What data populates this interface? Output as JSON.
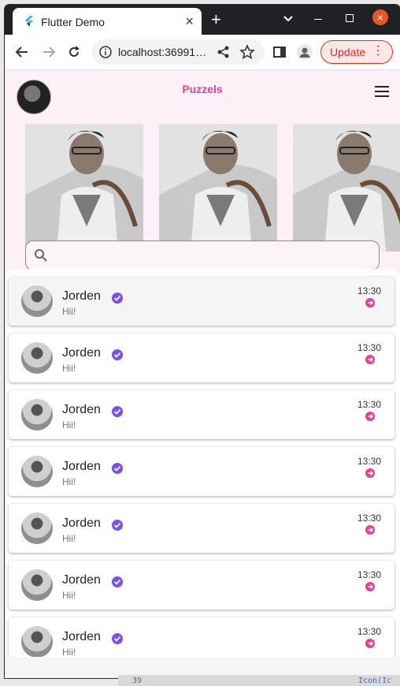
{
  "browser": {
    "tab_title": "Flutter Demo",
    "tab_close_icon": "close-icon",
    "url": "localhost:36991…",
    "update_label": "Update",
    "update_menu": "⋮"
  },
  "app": {
    "title": "Puzzels",
    "search_placeholder": "",
    "accent_color": "#e7408f",
    "chats": [
      {
        "name": "Jorden",
        "message": "Hii!",
        "time": "13:30"
      },
      {
        "name": "Jorden",
        "message": "Hii!",
        "time": "13:30"
      },
      {
        "name": "Jorden",
        "message": "Hii!",
        "time": "13:30"
      },
      {
        "name": "Jorden",
        "message": "Hii!",
        "time": "13:30"
      },
      {
        "name": "Jorden",
        "message": "Hii!",
        "time": "13:30"
      },
      {
        "name": "Jorden",
        "message": "Hii!",
        "time": "13:30"
      },
      {
        "name": "Jorden",
        "message": "Hii!",
        "time": "13:30"
      }
    ]
  },
  "ide": {
    "line_number": "39",
    "code_fragment": "Icon(Ic"
  }
}
